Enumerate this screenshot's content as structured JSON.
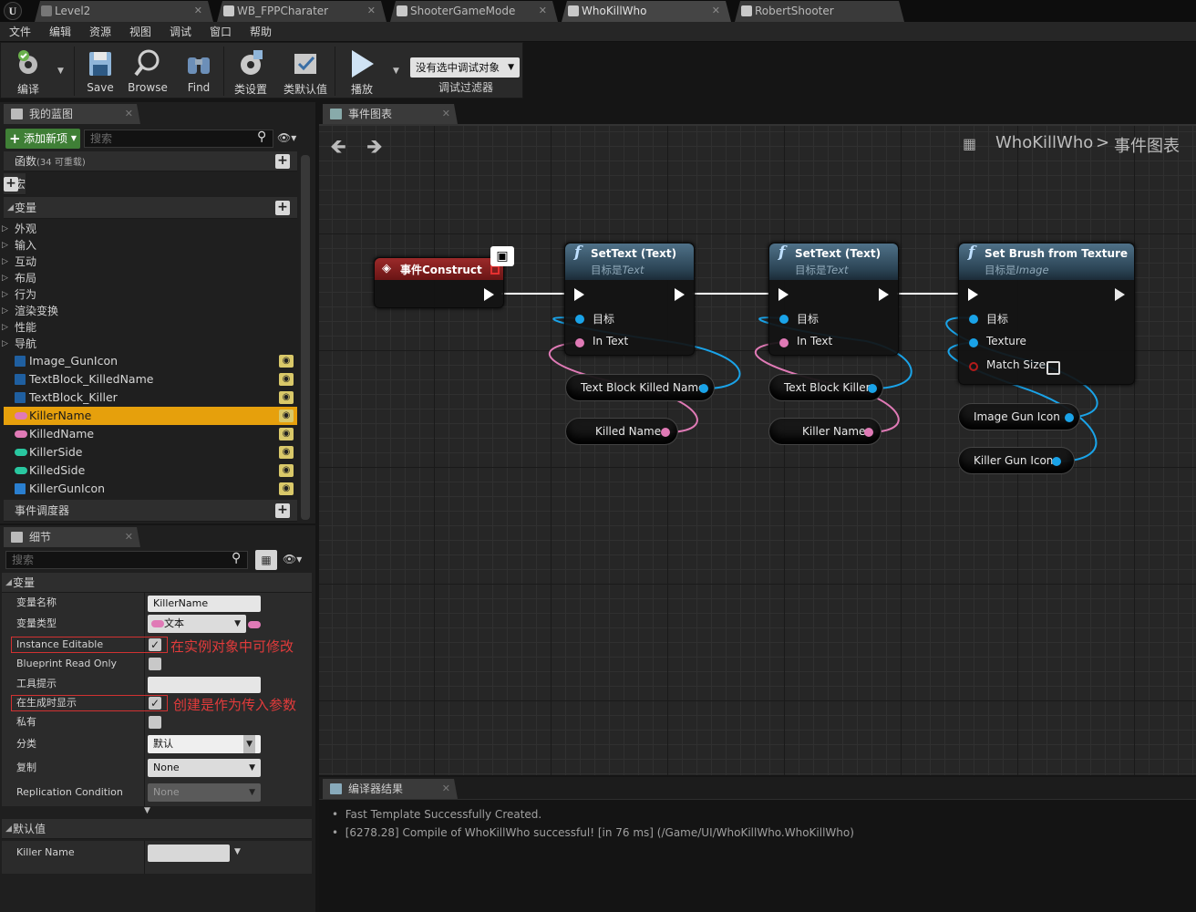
{
  "titlebar": {
    "logo": "U",
    "tabs": [
      "Level2",
      "WB_FPPCharater",
      "ShooterGameMode",
      "WhoKillWho",
      "RobertShooter"
    ]
  },
  "menu": [
    "文件",
    "编辑",
    "资源",
    "视图",
    "调试",
    "窗口",
    "帮助"
  ],
  "toolbar": {
    "buttons": [
      "编译",
      "Save",
      "Browse",
      "Find",
      "类设置",
      "类默认值",
      "播放"
    ],
    "debug_select": "没有选中调试对象",
    "debug_filter": "调试过滤器"
  },
  "my_blueprint": {
    "tab": "我的蓝图",
    "add_new": "添加新项",
    "search_placeholder": "搜索",
    "functions_label": "函数",
    "functions_note": "(34 可重载)",
    "macros": "宏",
    "variables": "变量",
    "categories": [
      "外观",
      "输入",
      "互动",
      "布局",
      "行为",
      "渲染变换",
      "性能",
      "导航"
    ],
    "vars": [
      {
        "name": "Image_GunIcon",
        "color": "#2a7fd0"
      },
      {
        "name": "TextBlock_KilledName",
        "color": "#2a7fd0"
      },
      {
        "name": "TextBlock_Killer",
        "color": "#2a7fd0"
      },
      {
        "name": "KillerName",
        "color": "#e07ab6"
      },
      {
        "name": "KilledName",
        "color": "#e07ab6"
      },
      {
        "name": "KillerSide",
        "color": "#29c7a0"
      },
      {
        "name": "KilledSide",
        "color": "#29c7a0"
      },
      {
        "name": "KillerGunIcon",
        "color": "#2a7fd0"
      }
    ],
    "event_dispatchers": "事件调度器"
  },
  "details": {
    "tab": "细节",
    "search_placeholder": "搜索",
    "section_variable": "变量",
    "var_name_label": "变量名称",
    "var_name": "KillerName",
    "var_type_label": "变量类型",
    "var_type": "文本",
    "instance_editable": "Instance Editable",
    "instance_note": "在实例对象中可修改",
    "bp_readonly": "Blueprint Read Only",
    "tooltip_label": "工具提示",
    "expose_spawn": "在生成时显示",
    "expose_note": "创建是作为传入参数",
    "private": "私有",
    "category_label": "分类",
    "category_value": "默认",
    "replication_label": "复制",
    "replication_value": "None",
    "rep_cond_label": "Replication Condition",
    "rep_cond_value": "None",
    "section_default": "默认值",
    "default_label": "Killer Name"
  },
  "graph": {
    "tab": "事件图表",
    "breadcrumb_root": "WhoKillWho",
    "breadcrumb_sep": ">",
    "breadcrumb_leaf": "事件图表",
    "event_node": "事件Construct",
    "node1": {
      "title": "SetText (Text)",
      "sub_prefix": "目标是",
      "sub_type": "Text",
      "target": "目标",
      "param": "In Text"
    },
    "node2": {
      "title": "SetText (Text)",
      "sub_prefix": "目标是",
      "sub_type": "Text",
      "target": "目标",
      "param": "In Text"
    },
    "node3": {
      "title": "Set Brush from Texture",
      "sub_prefix": "目标是",
      "sub_type": "Image",
      "target": "目标",
      "param": "Texture",
      "param2": "Match Size"
    },
    "getters": [
      "Text Block Killed Name",
      "Killed Name",
      "Text Block Killer",
      "Killer Name",
      "Image Gun Icon",
      "Killer Gun Icon"
    ]
  },
  "compiler": {
    "tab": "编译器结果",
    "lines": [
      "Fast Template Successfully Created.",
      "[6278.28] Compile of WhoKillWho successful! [in 76 ms] (/Game/UI/WhoKillWho.WhoKillWho)"
    ]
  }
}
